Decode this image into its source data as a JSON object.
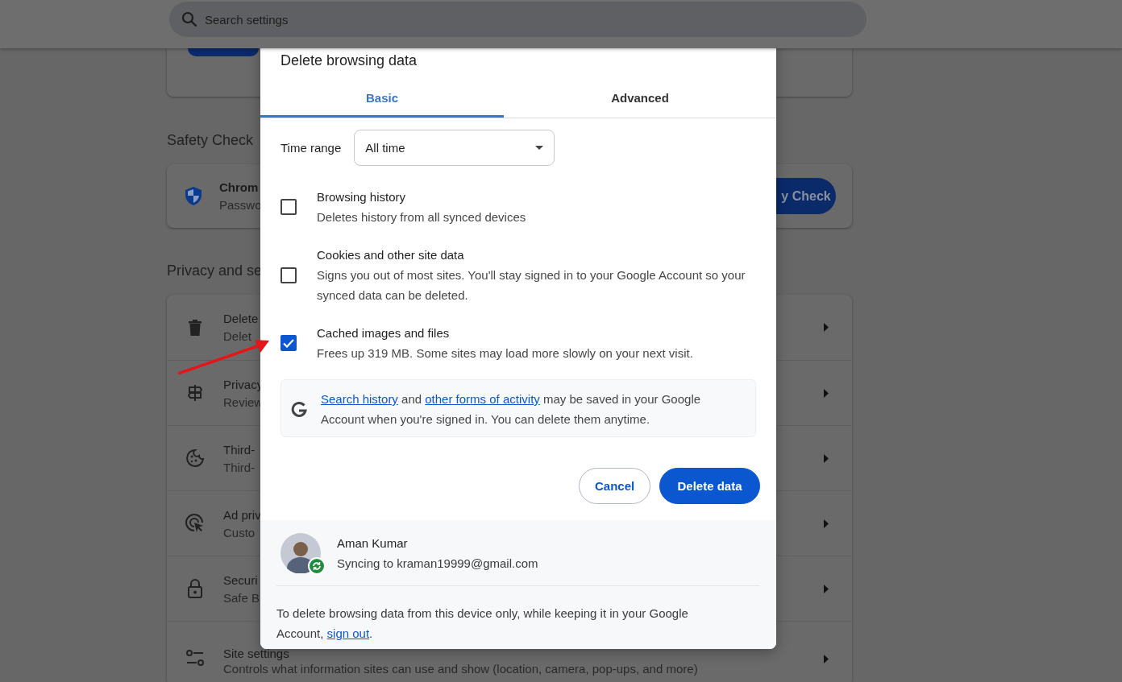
{
  "search": {
    "placeholder": "Search settings"
  },
  "safety_check": {
    "heading": "Safety Check",
    "title": "Chrom",
    "subtitle": "Passwo",
    "button": "y Check"
  },
  "privacy": {
    "heading": "Privacy and se",
    "items": [
      {
        "title": "Delete",
        "subtitle": "Delet"
      },
      {
        "title": "Privacy",
        "subtitle": "Review"
      },
      {
        "title": "Third-",
        "subtitle": "Third-"
      },
      {
        "title": "Ad priv",
        "subtitle": "Custo"
      },
      {
        "title": "Securi",
        "subtitle": "Safe B"
      },
      {
        "title": "Site settings",
        "subtitle": "Controls what information sites can use and show (location, camera, pop-ups, and more)"
      }
    ]
  },
  "dialog": {
    "title": "Delete browsing data",
    "tabs": [
      {
        "label": "Basic",
        "selected": true
      },
      {
        "label": "Advanced",
        "selected": false
      }
    ],
    "time_range": {
      "label": "Time range",
      "value": "All time"
    },
    "options": [
      {
        "title": "Browsing history",
        "description": "Deletes history from all synced devices",
        "checked": false
      },
      {
        "title": "Cookies and other site data",
        "description": "Signs you out of most sites. You'll stay signed in to your Google Account so your synced data can be deleted.",
        "checked": false
      },
      {
        "title": "Cached images and files",
        "description": "Frees up 319 MB. Some sites may load more slowly on your next visit.",
        "checked": true
      }
    ],
    "notice": [
      {
        "kind": "link",
        "text": "Search history"
      },
      {
        "kind": "text",
        "text": " and "
      },
      {
        "kind": "link",
        "text": "other forms of activity"
      },
      {
        "kind": "text",
        "text": " may be saved in your Google Account when you're signed in. You can delete them anytime."
      }
    ],
    "buttons": {
      "cancel": "Cancel",
      "confirm": "Delete data"
    },
    "account": {
      "name": "Aman Kumar",
      "status": "Syncing to kraman19999@gmail.com"
    },
    "footer": [
      {
        "kind": "text",
        "text": "To delete browsing data from this device only, while keeping it in your Google Account, "
      },
      {
        "kind": "link",
        "text": "sign out"
      },
      {
        "kind": "text",
        "text": "."
      }
    ]
  }
}
